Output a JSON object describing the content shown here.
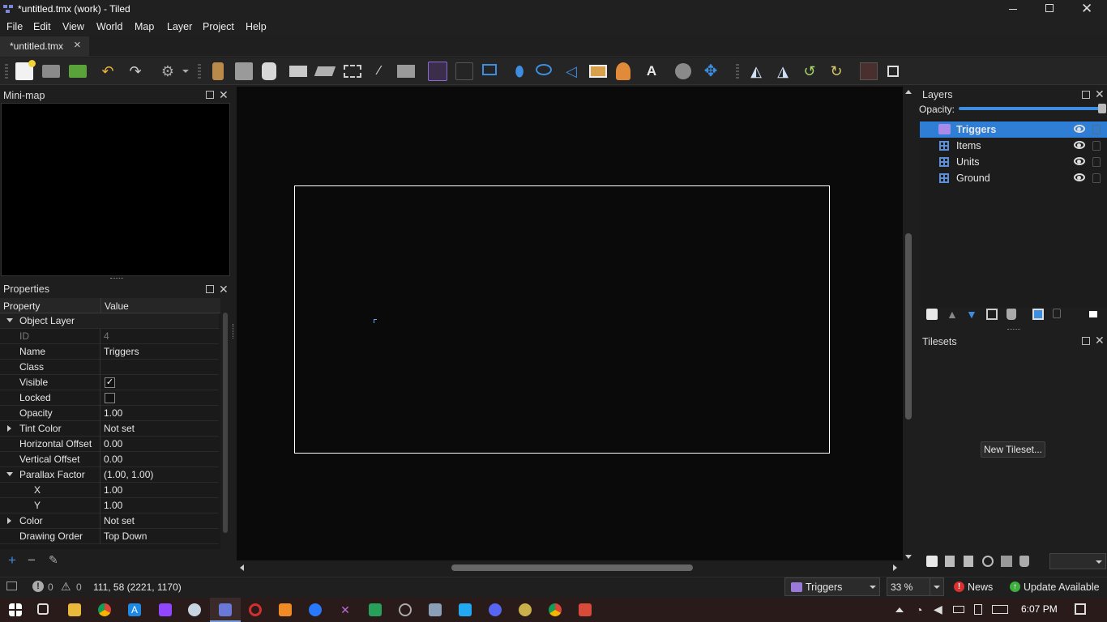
{
  "window": {
    "title": "*untitled.tmx (work) - Tiled",
    "controls": [
      "minimize-icon",
      "restore-icon",
      "close-icon"
    ]
  },
  "menu": [
    "File",
    "Edit",
    "View",
    "World",
    "Map",
    "Layer",
    "Project",
    "Help"
  ],
  "tabs": [
    {
      "label": "*untitled.tmx",
      "close": "×"
    }
  ],
  "minimap": {
    "title": "Mini-map"
  },
  "properties": {
    "title": "Properties",
    "headers": {
      "property": "Property",
      "value": "Value"
    },
    "rows": [
      {
        "key": "Object Layer",
        "value": "",
        "type": "group",
        "expanded": true
      },
      {
        "key": "ID",
        "value": "4",
        "type": "readonly"
      },
      {
        "key": "Name",
        "value": "Triggers"
      },
      {
        "key": "Class",
        "value": ""
      },
      {
        "key": "Visible",
        "value": "",
        "type": "checkbox",
        "checked": true
      },
      {
        "key": "Locked",
        "value": "",
        "type": "checkbox",
        "checked": false
      },
      {
        "key": "Opacity",
        "value": "1.00"
      },
      {
        "key": "Tint Color",
        "value": "Not set",
        "type": "collapsed"
      },
      {
        "key": "Horizontal Offset",
        "value": "0.00"
      },
      {
        "key": "Vertical Offset",
        "value": "0.00"
      },
      {
        "key": "Parallax Factor",
        "value": "(1.00, 1.00)",
        "type": "expanded"
      },
      {
        "key": "X",
        "value": "1.00",
        "type": "sub"
      },
      {
        "key": "Y",
        "value": "1.00",
        "type": "sub"
      },
      {
        "key": "Color",
        "value": "Not set",
        "type": "collapsed"
      },
      {
        "key": "Drawing Order",
        "value": "Top Down"
      }
    ]
  },
  "layers": {
    "title": "Layers",
    "opacity_label": "Opacity:",
    "opacity": 1.0,
    "items": [
      {
        "name": "Triggers",
        "icon": "object-layer-icon",
        "selected": true
      },
      {
        "name": "Items",
        "icon": "tile-layer-icon",
        "selected": false
      },
      {
        "name": "Units",
        "icon": "tile-layer-icon",
        "selected": false
      },
      {
        "name": "Ground",
        "icon": "tile-layer-icon",
        "selected": false
      }
    ]
  },
  "tilesets": {
    "title": "Tilesets",
    "new_button": "New Tileset..."
  },
  "status": {
    "errors": "0",
    "warnings": "0",
    "coords": "111, 58 (2221, 1170)",
    "current_layer": "Triggers",
    "zoom": "33 %",
    "news": "News",
    "update": "Update Available"
  },
  "taskbar": {
    "time": "6:07 PM"
  },
  "colors": {
    "accent": "#3d8ee0",
    "selection": "#2f7ed6",
    "canvas": "#0a0a0a"
  }
}
